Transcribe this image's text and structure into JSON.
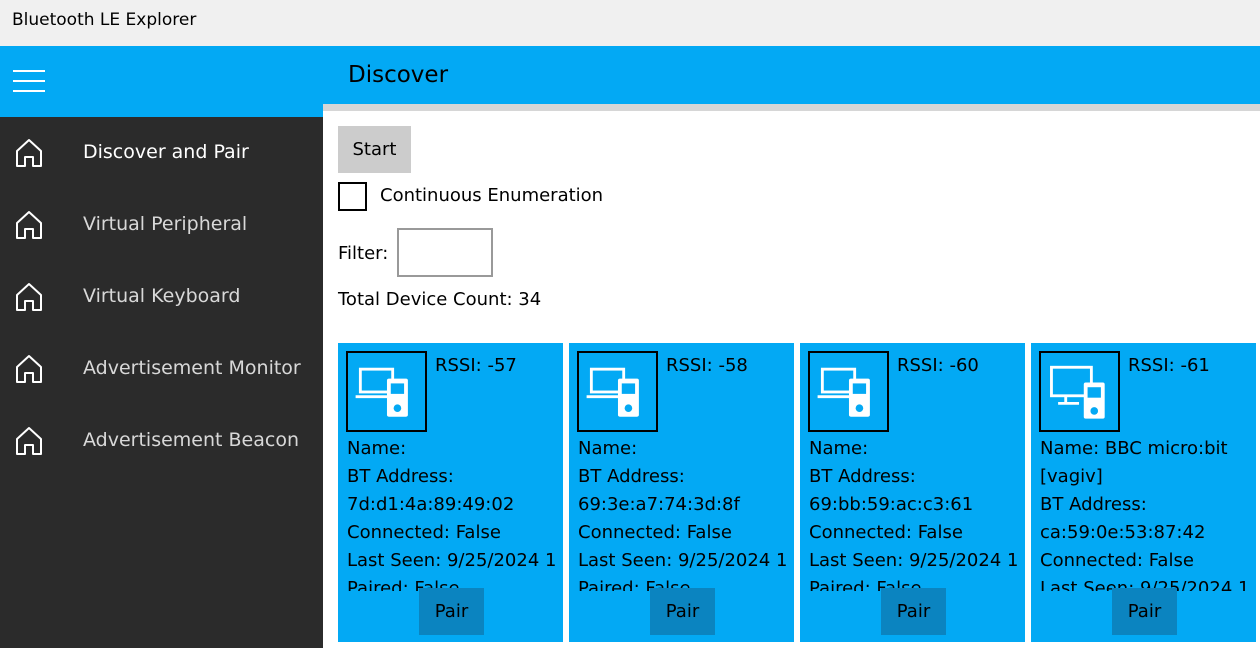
{
  "window": {
    "title": "Bluetooth LE Explorer"
  },
  "header": {
    "title": "Discover"
  },
  "sidebar": {
    "items": [
      {
        "label": "Discover and Pair",
        "icon": "home-icon",
        "active": true
      },
      {
        "label": "Virtual Peripheral",
        "icon": "home-icon"
      },
      {
        "label": "Virtual Keyboard",
        "icon": "home-icon"
      },
      {
        "label": "Advertisement Monitor",
        "icon": "home-icon"
      },
      {
        "label": "Advertisement Beacon",
        "icon": "home-icon"
      }
    ]
  },
  "controls": {
    "start_label": "Start",
    "continuous_label": "Continuous Enumeration",
    "continuous_checked": false,
    "filter_label": "Filter:",
    "filter_value": "",
    "device_count": "Total Device Count: 34"
  },
  "devices": [
    {
      "rssi": "RSSI: -57",
      "lines": [
        "Name:",
        "BT Address:",
        "7d:d1:4a:89:49:02",
        "Connected: False",
        "Last Seen: 9/25/2024 1",
        "Paired: False"
      ],
      "pair_label": "Pair"
    },
    {
      "rssi": "RSSI: -58",
      "lines": [
        "Name:",
        "BT Address:",
        "69:3e:a7:74:3d:8f",
        "Connected: False",
        "Last Seen: 9/25/2024 1",
        "Paired: False"
      ],
      "pair_label": "Pair"
    },
    {
      "rssi": "RSSI: -60",
      "lines": [
        "Name:",
        "BT Address:",
        "69:bb:59:ac:c3:61",
        "Connected: False",
        "Last Seen: 9/25/2024 1",
        "Paired: False"
      ],
      "pair_label": "Pair"
    },
    {
      "rssi": "RSSI: -61",
      "lines": [
        "Name: BBC micro:bit",
        "[vagiv]",
        "BT Address:",
        "ca:59:0e:53:87:42",
        "Connected: False",
        "Last Seen: 9/25/2024 1"
      ],
      "pair_label": "Pair"
    }
  ],
  "colors": {
    "accent": "#03a9f4",
    "sidebar": "#2b2b2b",
    "pair_button": "#0b84c0",
    "titlebar": "#f0f0f0"
  }
}
